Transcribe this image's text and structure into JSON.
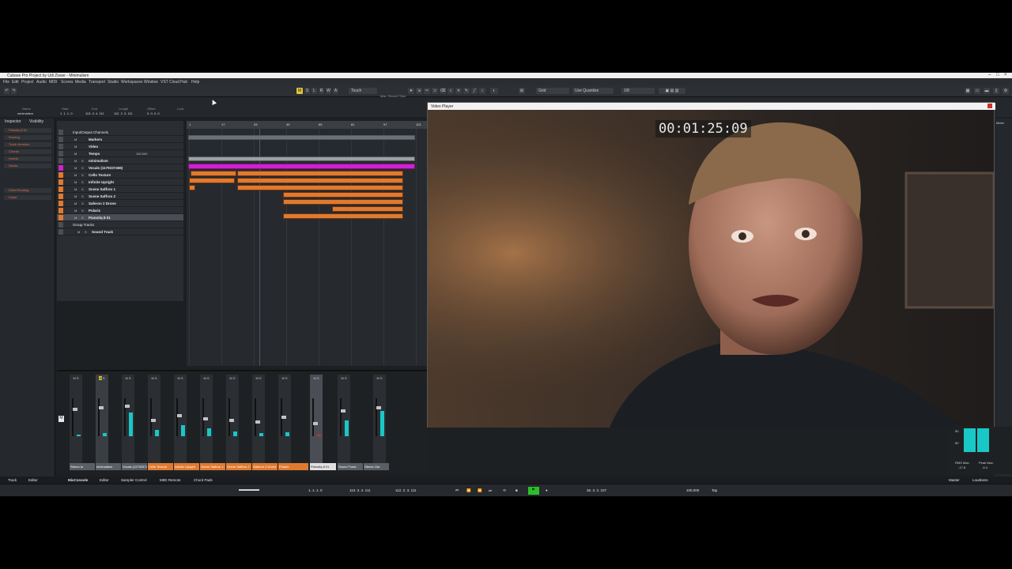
{
  "window": {
    "title": "Cubase Pro Project by Udi Zisser - Minimalism"
  },
  "menu": [
    "File",
    "Edit",
    "Project",
    "Audio",
    "MIDI",
    "Scores",
    "Media",
    "Transport",
    "Studio",
    "Workspaces",
    "Window",
    "VST Cloud",
    "Hub",
    "Help"
  ],
  "toolbar": {
    "automation_mode": "Touch",
    "snap_type": "Grid",
    "quantize_mode": "Use Quantize",
    "quantize_value": "1/8",
    "rec_time": "Max. Record Time"
  },
  "infoline": {
    "headers": [
      "Name",
      "Start",
      "End",
      "Length",
      "Offset",
      "Lock"
    ],
    "values": [
      "minimalism",
      "1. 1. 1. 0",
      "113. 3. 4. 111",
      "112. 2. 3. 111",
      "0. 0. 0. 0",
      ""
    ]
  },
  "inspector": {
    "tabs": [
      "Inspector",
      "Visibility"
    ],
    "sections": [
      "Pianotiq 8 01",
      "Routing",
      "Track Versions",
      "Chords",
      "Inserts",
      "Sends",
      "Direct Routing",
      "Fader"
    ]
  },
  "tracks": [
    {
      "name": "Input/Output Channels",
      "color": "#4a4f55"
    },
    {
      "name": "Markers",
      "color": "#4a4f55"
    },
    {
      "name": "Video",
      "color": "#4a4f55"
    },
    {
      "name": "Tempo",
      "color": "#4a4f55"
    },
    {
      "name": "minimalism",
      "color": "#4a4f55"
    },
    {
      "name": "Vocals (1179337466)",
      "color": "#d020d0"
    },
    {
      "name": "Cello Texture",
      "color": "#e07a30"
    },
    {
      "name": "Infinite Upright",
      "color": "#e07a30"
    },
    {
      "name": "Scene Saffron 1",
      "color": "#e07a30"
    },
    {
      "name": "Scene Saffron 2",
      "color": "#e07a30"
    },
    {
      "name": "Saferon 2 Drone",
      "color": "#e07a30"
    },
    {
      "name": "Polaris",
      "color": "#e07a30"
    },
    {
      "name": "Pianotiq 8 01",
      "color": "#e07a30"
    },
    {
      "name": "Group Tracks",
      "color": "#4a4f55"
    },
    {
      "name": "Sound Track",
      "color": "#4a4f55"
    }
  ],
  "ruler": [
    "1",
    "17",
    "33",
    "49",
    "65",
    "81",
    "97",
    "113"
  ],
  "tempo_value": "100.000",
  "mixer": {
    "channels": [
      "Stereo In",
      "minimalism",
      "Vocals (1179337466)",
      "Cello Texture",
      "Infinite Upright",
      "Scene Saffron 1",
      "Scene Saffron 2",
      "Saferon 2 Drone",
      "Polaris",
      "Pianotiq 8 01",
      "Sound Track",
      "Stereo Out"
    ],
    "channel_colors": [
      "#5a5f66",
      "#5a5f66",
      "#5a5f66",
      "#e07a30",
      "#e07a30",
      "#e07a30",
      "#e07a30",
      "#e07a30",
      "#e07a30",
      "#e0e0e0",
      "#5a5f66",
      "#5a5f66"
    ]
  },
  "video": {
    "title": "Video Player",
    "timecode": "00:01:25:09"
  },
  "loudness": {
    "rms_label": "RMS Max.",
    "rms_val": "-17.8",
    "peak_label": "Peak Max.",
    "peak_val": "-4.4",
    "scale_top": "50",
    "scale_bot": "60"
  },
  "bottom_tabs": [
    "Track",
    "Editor",
    "MixConsole",
    "Editor",
    "Sampler Control",
    "MIDI Remote",
    "Chord Pads",
    "Master",
    "Loudness"
  ],
  "transport": {
    "left_locator": "1. 1. 1. 0",
    "right_locator": "113. 3. 4. 111",
    "length": "112. 2. 3. 111",
    "position": "36. 3. 2. 107",
    "tempo": "100.000",
    "tap": "Tap"
  },
  "right_zone": {
    "meter_label": "Meter"
  }
}
